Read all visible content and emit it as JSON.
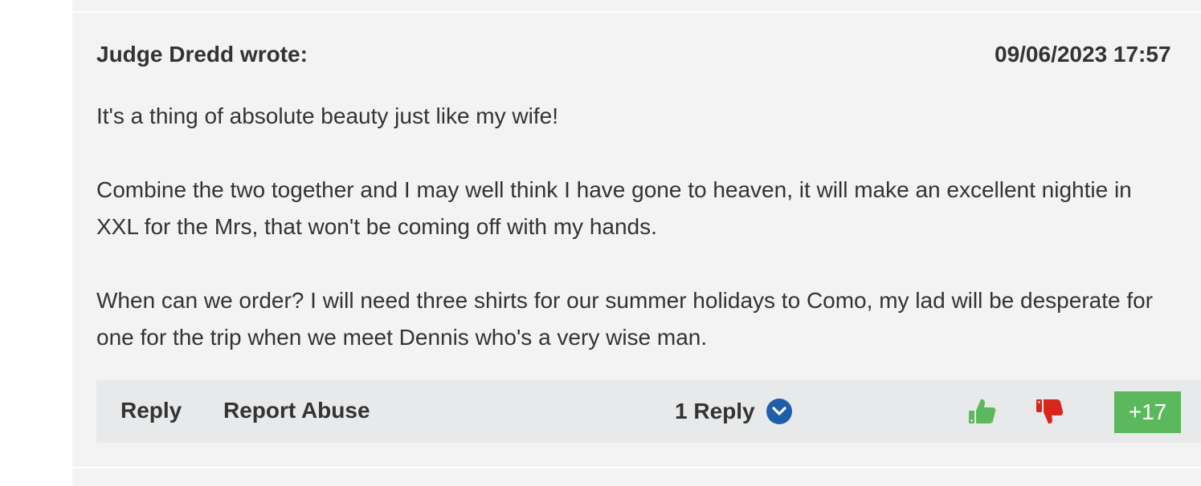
{
  "comment": {
    "author": "Judge Dredd wrote:",
    "timestamp": "09/06/2023 17:57",
    "paragraphs": [
      "It's a thing of absolute beauty just like my wife!",
      "Combine the two together and I may well think I have gone to heaven, it will make an excellent nightie in XXL for the Mrs, that won't be coming off with my hands.",
      "When can we order? I will need three shirts for our summer holidays to Como, my lad will be desperate for one for the trip when we meet Dennis who's a very wise man."
    ],
    "actions": {
      "reply_label": "Reply",
      "report_label": "Report Abuse",
      "replies_label": "1 Reply"
    },
    "score": "+17"
  },
  "colors": {
    "background": "#f3f3f3",
    "action_bar": "#e8e9ea",
    "thumb_up": "#5cb85c",
    "thumb_down": "#d9261c",
    "chevron_circle": "#1f5fa8",
    "score_badge": "#5cb85c"
  },
  "icons": {
    "replies_toggle": "chevron-down-icon",
    "upvote": "thumbs-up-icon",
    "downvote": "thumbs-down-icon"
  }
}
